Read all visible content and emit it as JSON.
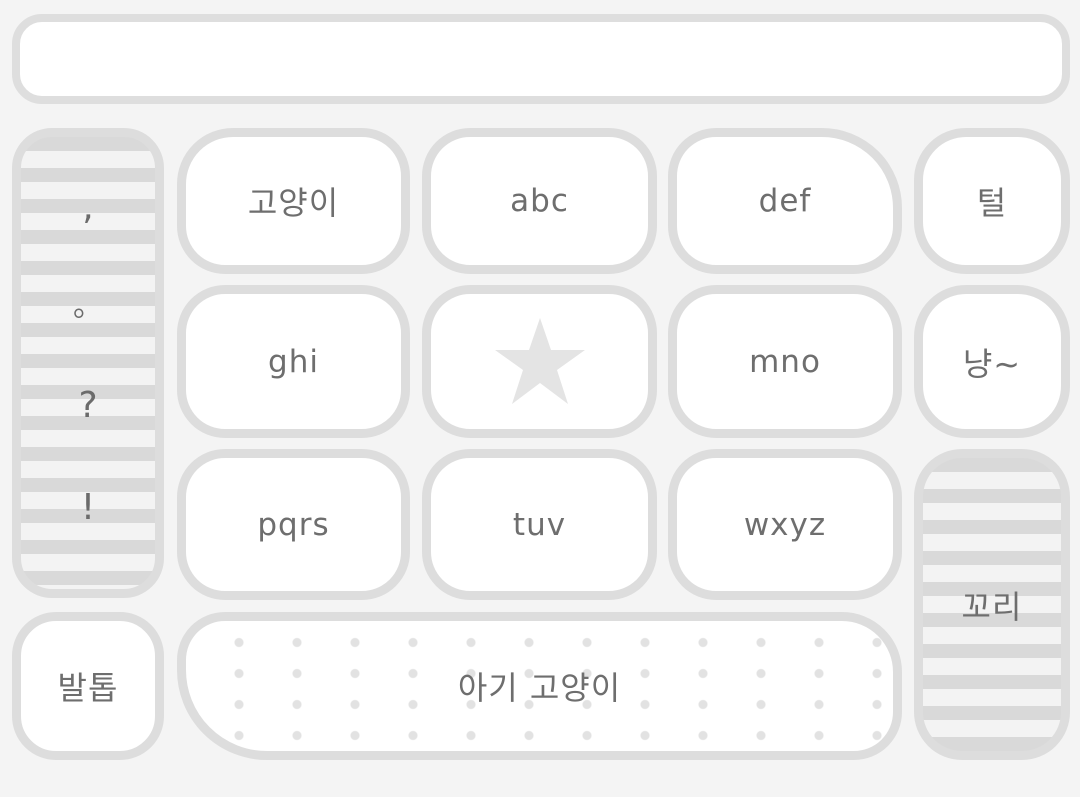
{
  "input": {
    "value": ""
  },
  "punctuation": [
    ",",
    "。",
    "?",
    "!"
  ],
  "keys": {
    "k1": "고양이",
    "k2": "abc",
    "k3": "def",
    "k4": "ghi",
    "k6": "mno",
    "k7": "pqrs",
    "k8": "tuv",
    "k9": "wxyz"
  },
  "side": {
    "fur": "털",
    "meow": "냥~",
    "tail": "꼬리"
  },
  "bottom": {
    "paw": "발톱",
    "space": "아기 고양이"
  },
  "colors": {
    "key_bg": "#ffffff",
    "key_border": "#dddddd",
    "text": "#6e6e6e",
    "page_bg": "#f4f4f4"
  },
  "icons": {
    "center_key": "star-icon"
  }
}
